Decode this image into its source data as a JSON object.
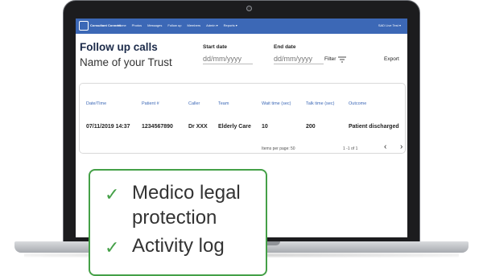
{
  "navbar": {
    "logo_text": "Consultant Connect",
    "items": [
      "Home",
      "Photos",
      "Messages",
      "Follow up",
      "Members",
      "Admin ▾",
      "Reports ▾"
    ],
    "user_label": "SAD Live Test ▾"
  },
  "header": {
    "title": "Follow up calls",
    "trust_name": "Name of your Trust",
    "start_date_label": "Start date",
    "start_date_placeholder": "dd/mm/yyyy",
    "end_date_label": "End date",
    "end_date_placeholder": "dd/mm/yyyy",
    "filter_label": "Filter",
    "export_label": "Export"
  },
  "table": {
    "columns": [
      "Date/Time",
      "Patient #",
      "Caller",
      "Team",
      "Wait time (sec)",
      "Talk time (sec)",
      "Outcome"
    ],
    "rows": [
      [
        "07/11/2019 14:37",
        "1234567890",
        "Dr XXX",
        "Elderly Care",
        "10",
        "200",
        "Patient discharged"
      ]
    ],
    "items_per_page_label": "Items per page:",
    "items_per_page_value": "50",
    "range_label": "1 -1 of 1"
  },
  "callout": {
    "features": [
      "Medico legal",
      "protection",
      "Activity log"
    ]
  },
  "colors": {
    "navbar": "#3c68b6",
    "accent_green": "#44a047",
    "title": "#1c2b4a"
  },
  "icons": [
    "filter-icon",
    "chevron-down-icon",
    "chevron-left-icon",
    "chevron-right-icon",
    "check-icon",
    "camera-icon"
  ]
}
